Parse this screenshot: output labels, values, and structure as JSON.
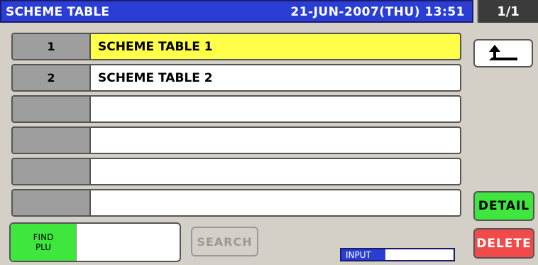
{
  "header": {
    "title": "SCHEME TABLE",
    "datetime": "21-JUN-2007(THU) 13:51",
    "page": "1/1"
  },
  "table": {
    "rows": [
      {
        "num": "1",
        "name": "SCHEME TABLE 1",
        "selected": true
      },
      {
        "num": "2",
        "name": "SCHEME TABLE 2",
        "selected": false
      },
      {
        "num": "",
        "name": "",
        "selected": false
      },
      {
        "num": "",
        "name": "",
        "selected": false
      },
      {
        "num": "",
        "name": "",
        "selected": false
      },
      {
        "num": "",
        "name": "",
        "selected": false
      }
    ]
  },
  "buttons": {
    "detail": "DETAIL",
    "delete": "DELETE",
    "search": "SEARCH",
    "find_plu_line1": "FIND",
    "find_plu_line2": "PLU",
    "back_icon": "back-arrow-icon"
  },
  "status": {
    "input_label": "INPUT"
  },
  "colors": {
    "title_bg": "#2a3ed6",
    "selected_row": "#ffff4a",
    "detail_green": "#3ee63e",
    "delete_red": "#f04a4a"
  }
}
